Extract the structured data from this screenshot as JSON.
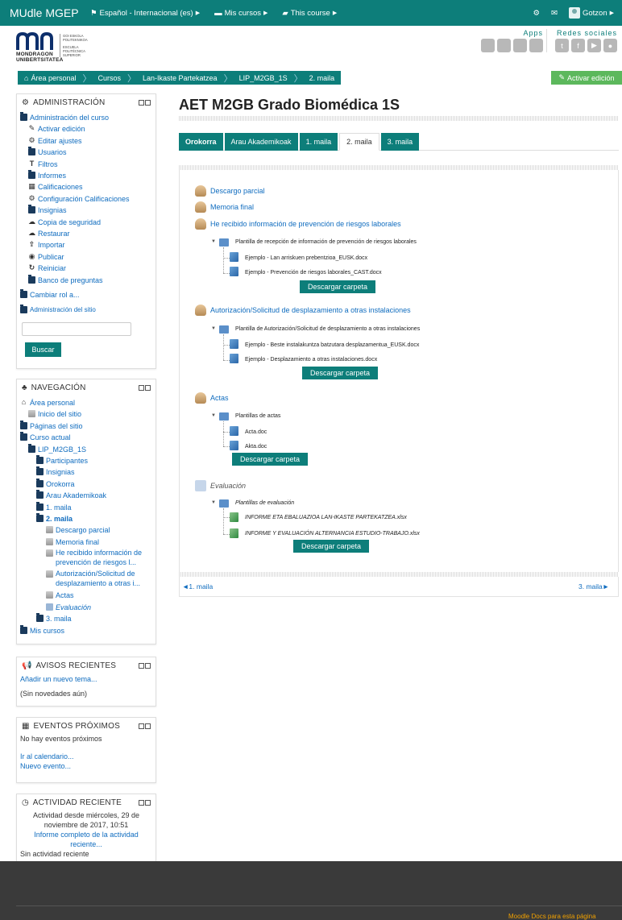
{
  "colors": {
    "brand": "#0d7e7a",
    "success": "#5cb85c",
    "link": "#0f6cbf"
  },
  "navbar": {
    "brand": "MUdle MGEP",
    "language": "Español - Internacional (es)",
    "mycourses": "Mis cursos",
    "thiscourse": "This course",
    "user": "Gotzon"
  },
  "header": {
    "logo_name": "MONDRAGON UNIBERTSITATEA",
    "logo_sub_1": "GOI ESKOLA POLITEKNIKOA",
    "logo_sub_2": "ESCUELA POLITÉCNICA SUPERIOR",
    "apps_label": "Apps",
    "redes_label": "Redes sociales"
  },
  "breadcrumb": [
    "Área personal",
    "Cursos",
    "Lan-Ikaste Partekatzea",
    "LIP_M2GB_1S",
    "2. maila"
  ],
  "edit_button": "Activar edición",
  "admin": {
    "title": "ADMINISTRACIÓN",
    "course_admin": "Administración del curso",
    "items": [
      "Activar edición",
      "Editar ajustes",
      "Usuarios",
      "Filtros",
      "Informes",
      "Calificaciones",
      "Configuración Calificaciones",
      "Insignias",
      "Copia de seguridad",
      "Restaurar",
      "Importar",
      "Publicar",
      "Reiniciar",
      "Banco de preguntas"
    ],
    "switch_role": "Cambiar rol a...",
    "site_admin": "Administración del sitio",
    "search_button": "Buscar"
  },
  "navigation": {
    "title": "NAVEGACIÓN",
    "home": "Área personal",
    "site_home": "Inicio del sitio",
    "site_pages": "Páginas del sitio",
    "current_course": "Curso actual",
    "course": "LIP_M2GB_1S",
    "sections": [
      "Participantes",
      "Insignias",
      "Orokorra",
      "Arau Akademikoak",
      "1. maila"
    ],
    "active_section": "2. maila",
    "activities": [
      "Descargo parcial",
      "Memoria final",
      "He recibido información de prevención de riesgos l...",
      "Autorización/Solicitud de desplazamiento a otras i...",
      "Actas"
    ],
    "evaluacion": "Evaluación",
    "next_section": "3. maila",
    "my_courses": "Mis cursos"
  },
  "news": {
    "title": "AVISOS RECIENTES",
    "add": "Añadir un nuevo tema...",
    "none": "(Sin novedades aún)"
  },
  "events": {
    "title": "EVENTOS PRÓXIMOS",
    "none": "No hay eventos próximos",
    "calendar": "Ir al calendario...",
    "new": "Nuevo evento..."
  },
  "activity": {
    "title": "ACTIVIDAD RECIENTE",
    "since": "Actividad desde miércoles, 29 de noviembre de 2017, 10:51",
    "report": "Informe completo de la actividad reciente...",
    "none": "Sin actividad reciente"
  },
  "main": {
    "title": "AET M2GB Grado Biomédica 1S",
    "tabs": [
      "Orokorra",
      "Arau Akademikoak",
      "1. maila",
      "2. maila",
      "3. maila"
    ],
    "activities": {
      "descargo": "Descargo parcial",
      "memoria": "Memoria final",
      "riesgos": "He recibido información de prevención de riesgos laborales",
      "riesgos_folder": "Plantilla de recepción de información de prevención de riesgos laborales",
      "riesgos_files": [
        "Ejemplo - Lan arriskuen prebentzioa_EUSK.docx",
        "Ejemplo - Prevención de riesgos laborales_CAST.docx"
      ],
      "autoriz": "Autorización/Solicitud de desplazamiento a otras instalaciones",
      "autoriz_folder": "Plantilla de Autorización/Solicitud de desplazamiento a otras instalaciones",
      "autoriz_files": [
        "Ejemplo - Beste instalakuntza batzutara desplazamentua_EUSK.docx",
        "Ejemplo - Desplazamiento a otras instalaciones.docx"
      ],
      "actas": "Actas",
      "actas_folder": "Plantillas de actas",
      "actas_files": [
        "Acta.doc",
        "Akta.doc"
      ],
      "evaluacion": "Evaluación",
      "eval_folder": "Plantillas de evaluación",
      "eval_files": [
        "INFORME ETA EBALUAZIOA LAN-IKASTE PARTEKATZEA.xlsx",
        "INFORME Y EVALUACIÓN ALTERNANCIA ESTUDIO-TRABAJO.xlsx"
      ],
      "download": "Descargar carpeta"
    },
    "prev": "◄1. maila",
    "next": "3. maila►"
  },
  "footer": {
    "docs_link": "Moodle Docs para esta página"
  }
}
